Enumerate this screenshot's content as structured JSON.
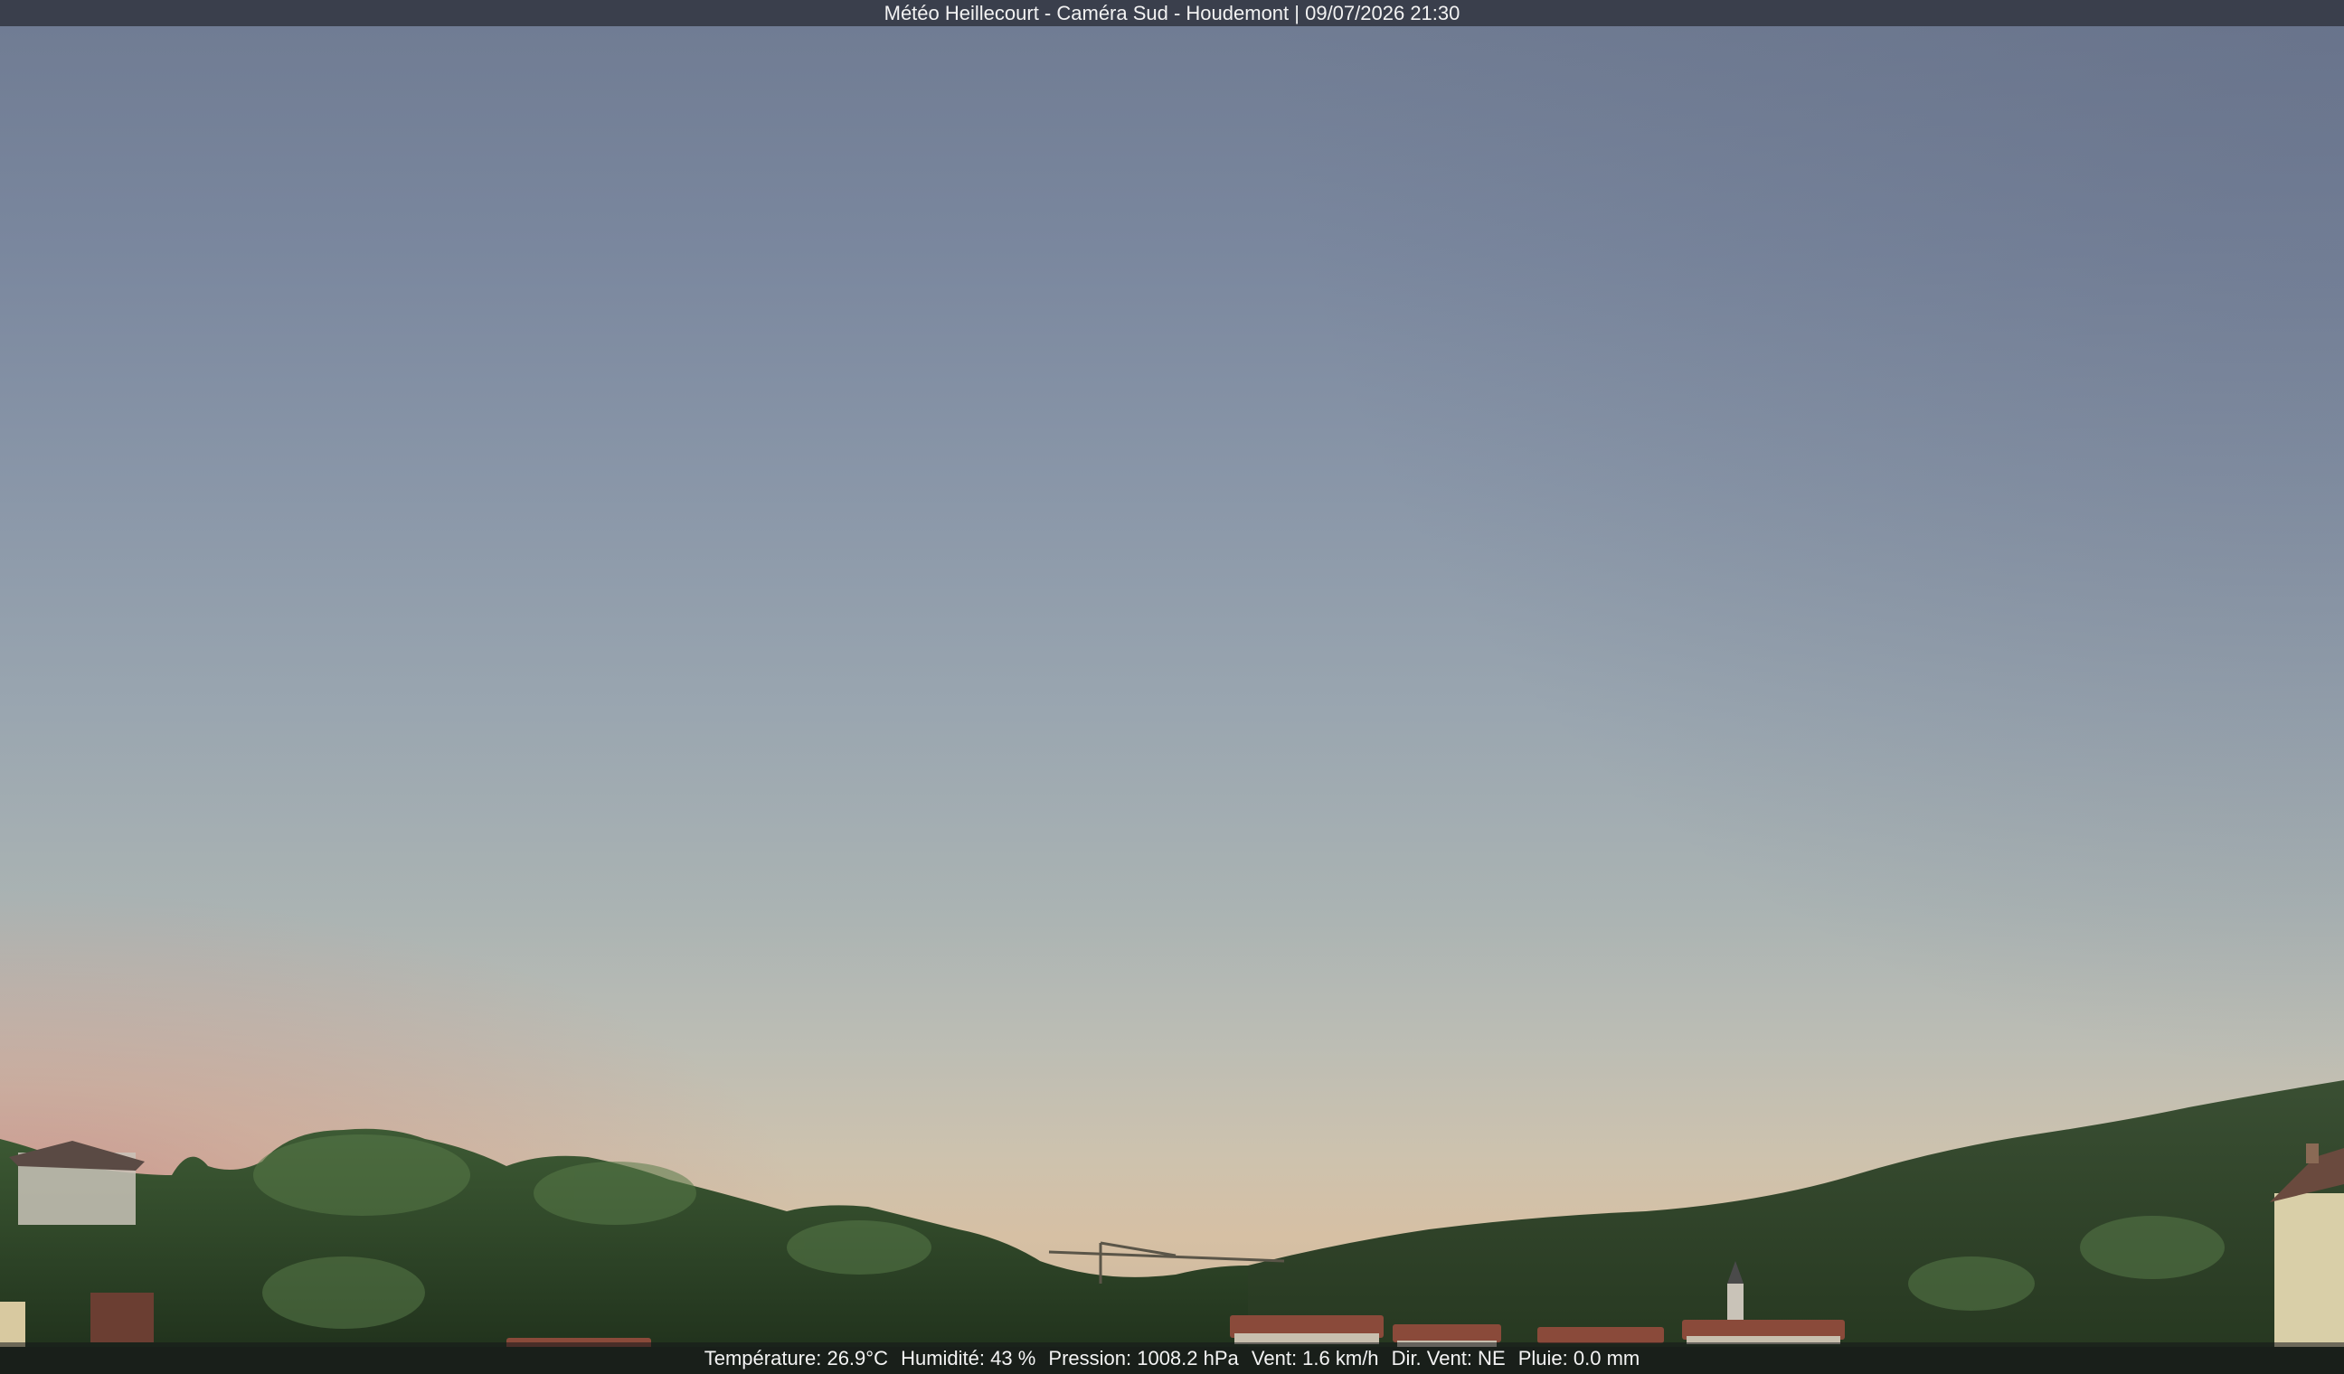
{
  "caption": {
    "title": "Météo Heillecourt - Caméra Sud - Houdemont | 09/07/2026 21:30"
  },
  "weather": {
    "temperature": "Température: 26.9°C",
    "humidity": "Humidité: 43 %",
    "pressure": "Pression: 1008.2 hPa",
    "wind_speed": "Vent: 1.6 km/h",
    "wind_dir": "Dir. Vent: NE",
    "rain": "Pluie: 0.0 mm"
  },
  "colors": {
    "title_bar": "#3a3f4c",
    "sky_top": "#6f7b92",
    "sky_horizon": "#d6c0a4",
    "trees": "#2e4a2a"
  }
}
